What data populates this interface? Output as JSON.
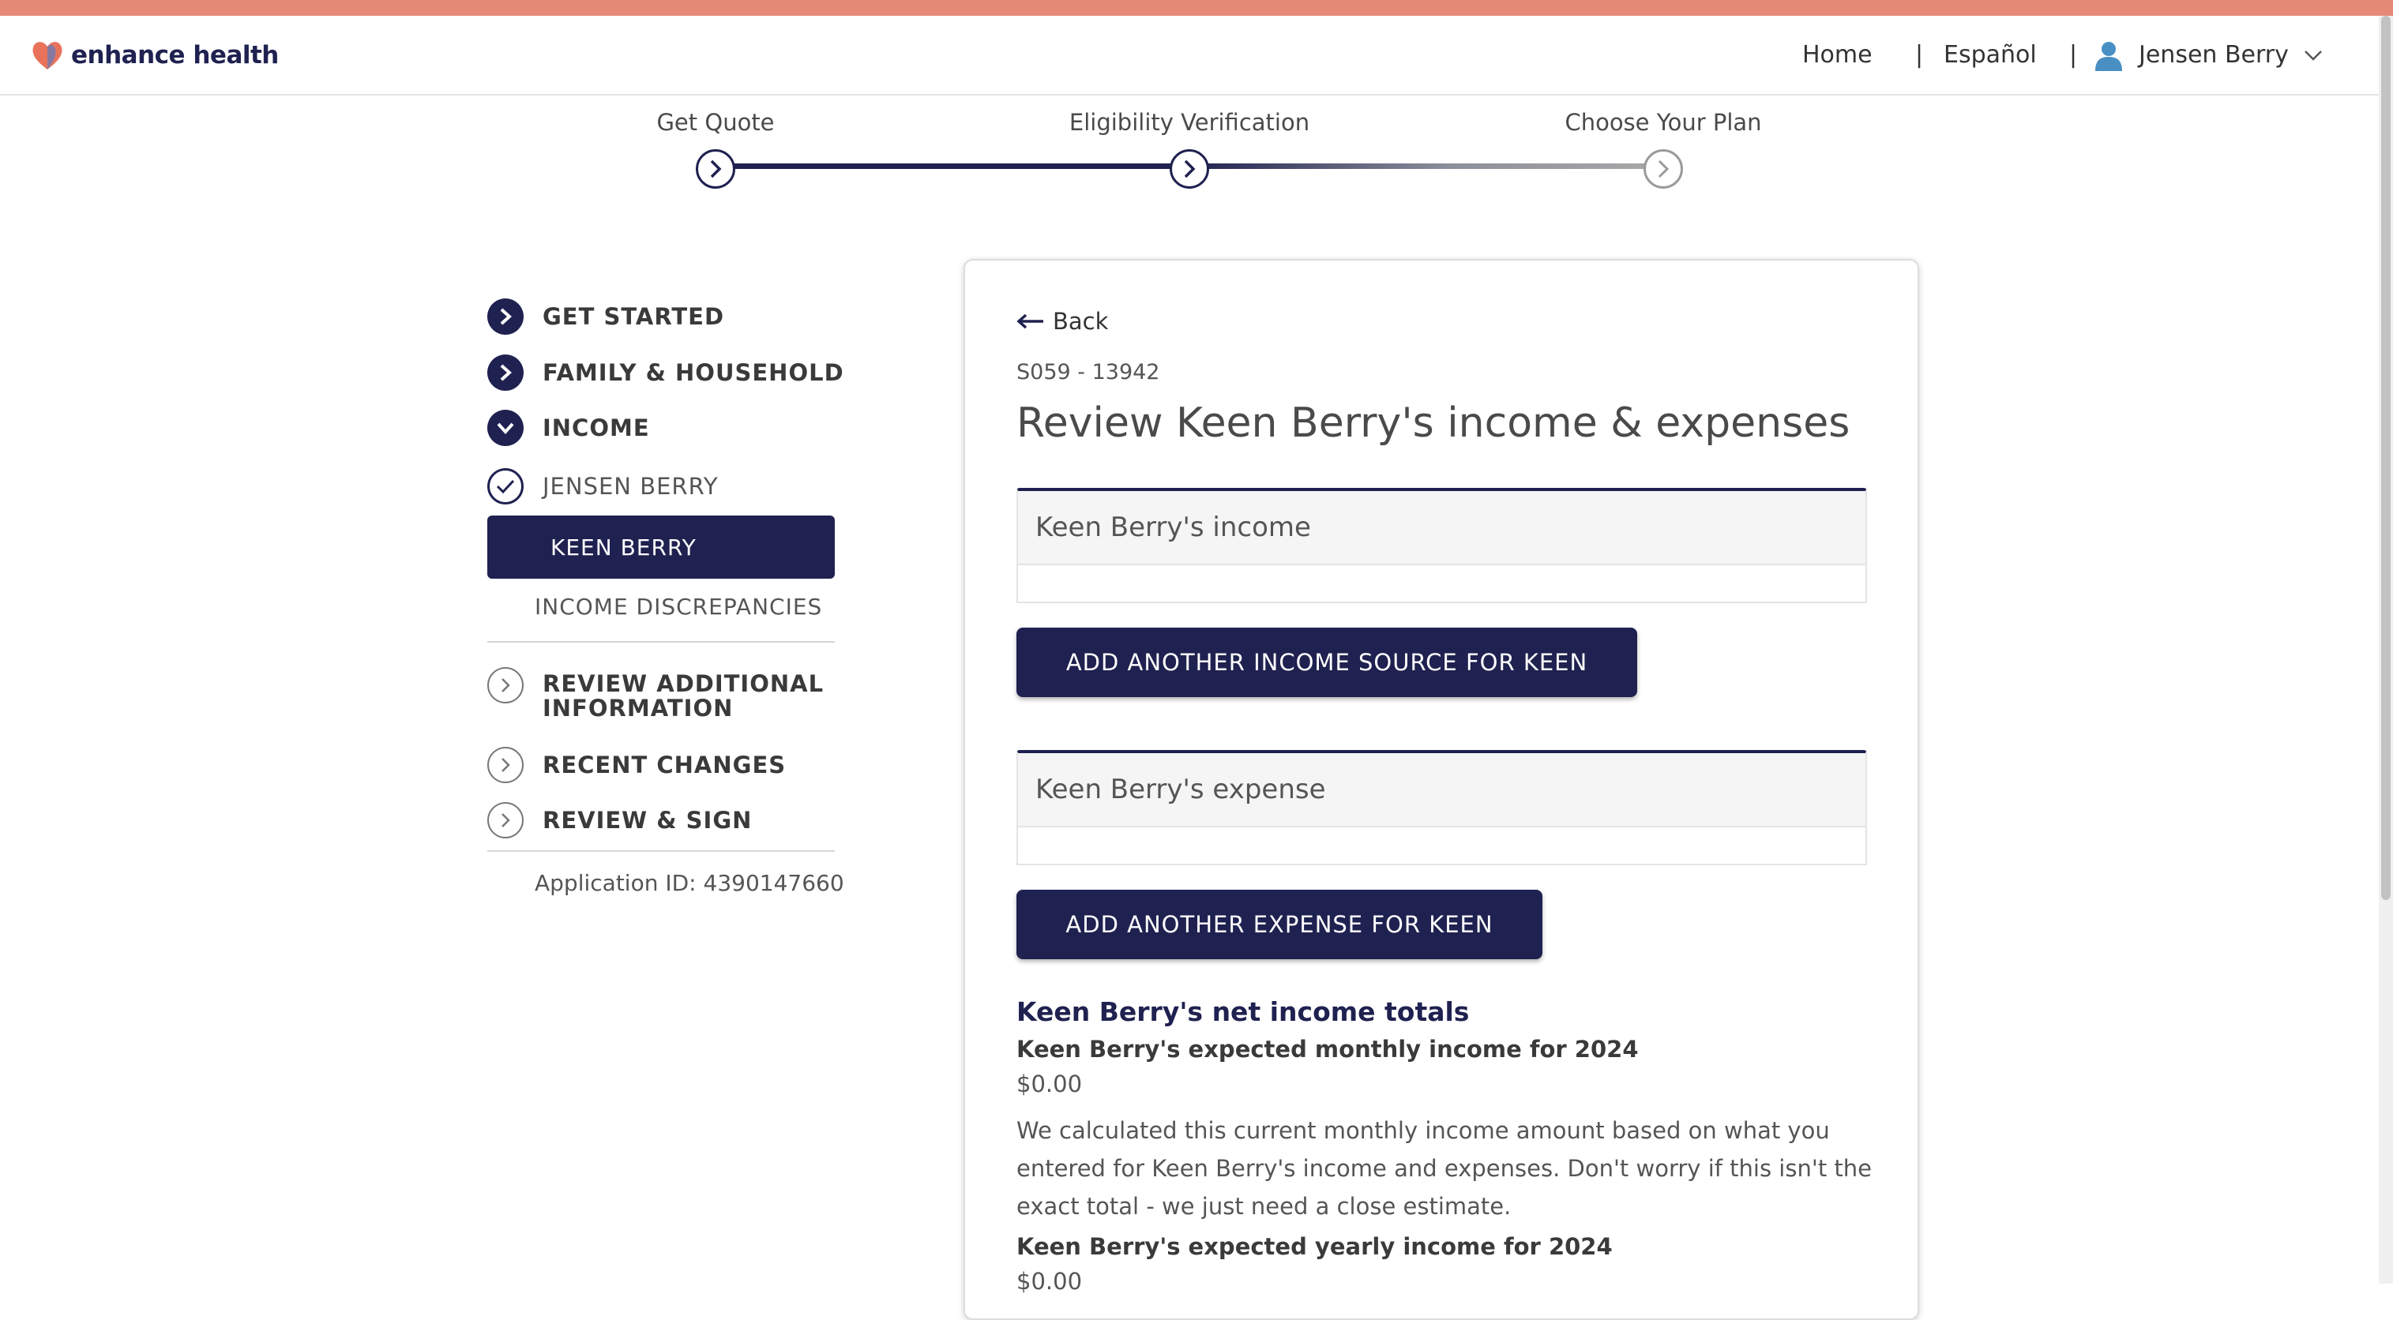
{
  "header": {
    "brand": "enhance health",
    "nav": {
      "home": "Home",
      "separator": "|",
      "spanish": "Español",
      "user": "Jensen Berry"
    }
  },
  "stepper": {
    "steps": [
      {
        "label": "Get Quote"
      },
      {
        "label": "Eligibility Verification"
      },
      {
        "label": "Choose Your Plan"
      }
    ]
  },
  "sidebar": {
    "items": [
      {
        "label": "GET STARTED"
      },
      {
        "label": "FAMILY & HOUSEHOLD"
      },
      {
        "label": "INCOME"
      },
      {
        "label": "JENSEN BERRY"
      },
      {
        "label": "KEEN BERRY"
      },
      {
        "label": "INCOME DISCREPANCIES"
      },
      {
        "label": "REVIEW ADDITIONAL INFORMATION"
      },
      {
        "label": "RECENT CHANGES"
      },
      {
        "label": "REVIEW & SIGN"
      }
    ],
    "application_id": "Application ID: 4390147660"
  },
  "main": {
    "back_label": "Back",
    "case_number": "S059 - 13942",
    "title": "Review Keen Berry's income & expenses",
    "income_panel_title": "Keen Berry's income",
    "add_income_button": "ADD ANOTHER INCOME SOURCE FOR KEEN",
    "expense_panel_title": "Keen Berry's expense",
    "add_expense_button": "ADD ANOTHER EXPENSE FOR KEEN",
    "net_totals_heading": "Keen Berry's net income totals",
    "monthly_label": "Keen Berry's expected monthly income for 2024",
    "monthly_value": "$0.00",
    "explanation": "We calculated this current monthly income amount based on what you entered for Keen Berry's income and expenses. Don't worry if this isn't the exact total - we just need a close estimate.",
    "yearly_label": "Keen Berry's expected yearly income for 2024",
    "yearly_value": "$0.00"
  },
  "colors": {
    "accent": "#1f2150",
    "top_bar": "#e68a78",
    "logo_heart": "#e8735a"
  },
  "icons": [
    "heart-logo-icon",
    "user-icon",
    "chevron-down-icon",
    "chevron-right-icon",
    "check-icon",
    "arrow-left-icon"
  ]
}
